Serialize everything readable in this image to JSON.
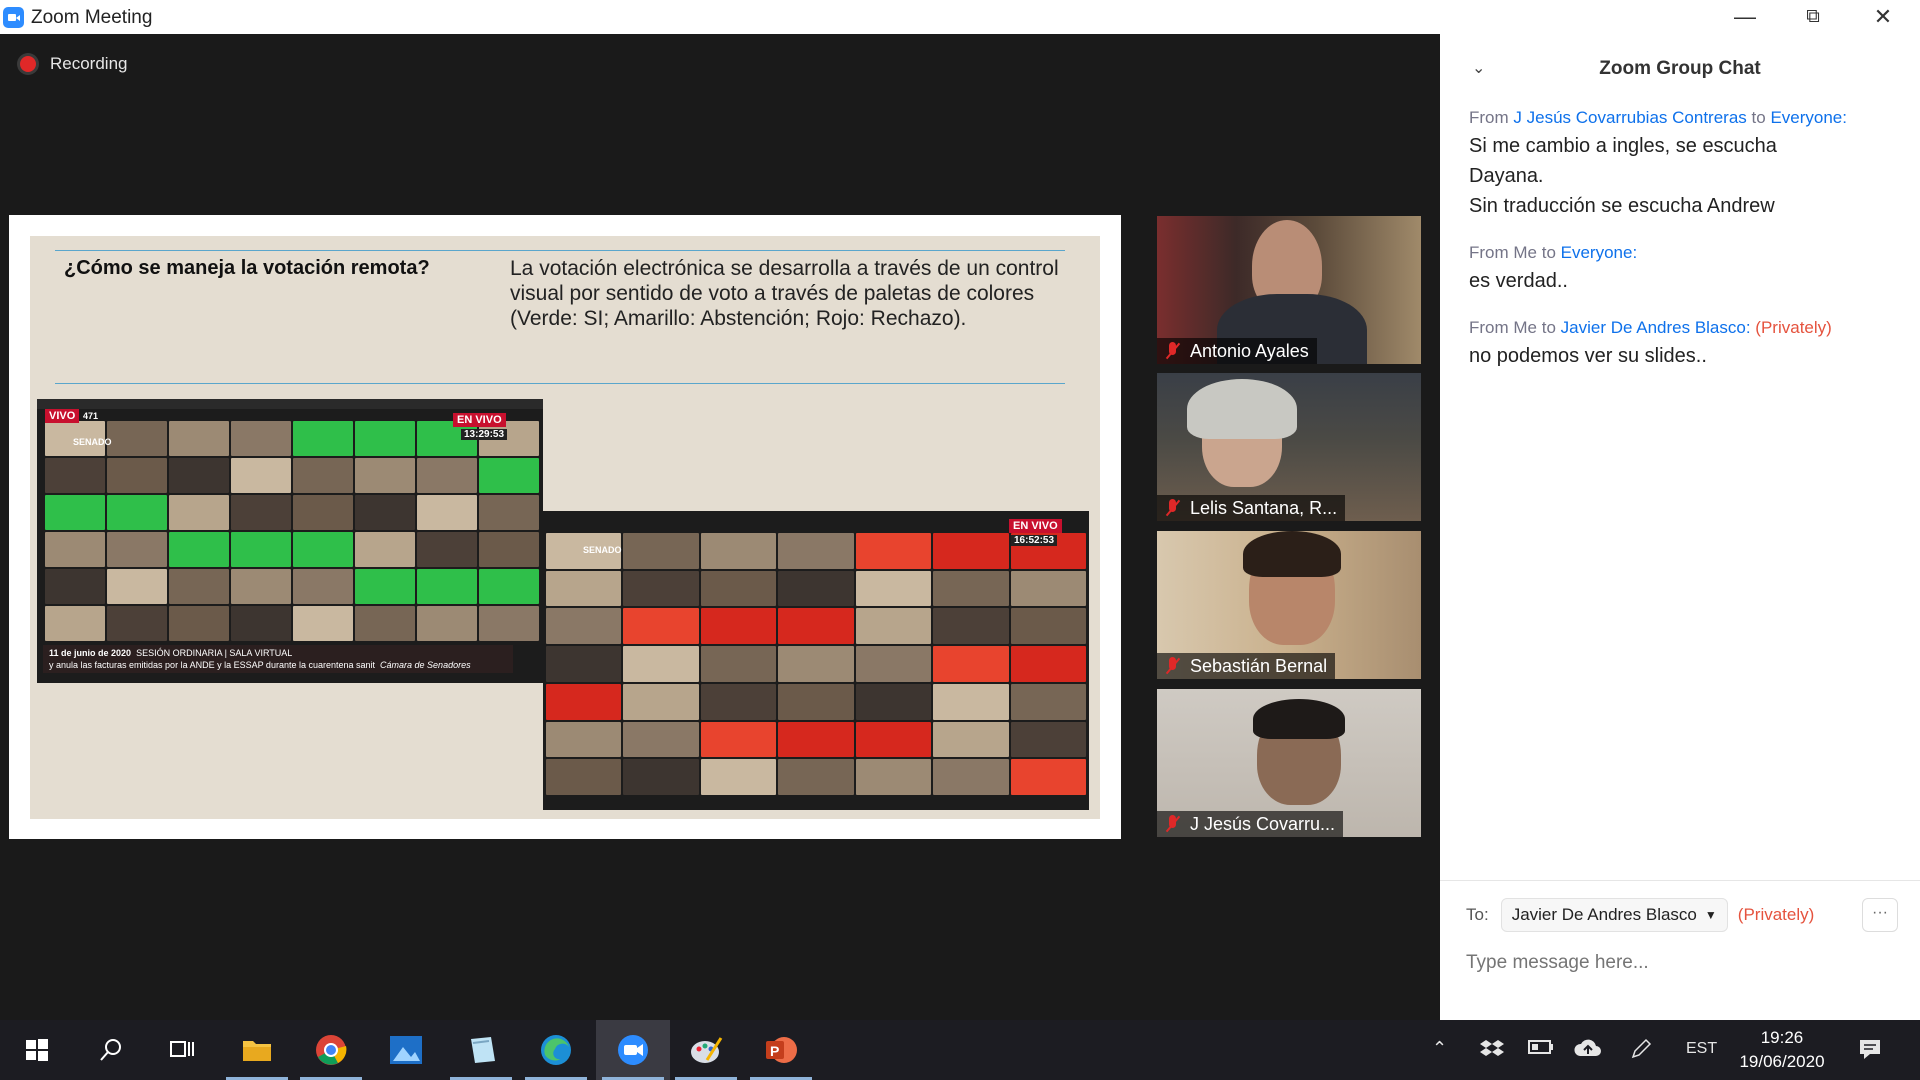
{
  "window": {
    "title": "Zoom Meeting",
    "minimize_glyph": "—",
    "restore_glyph": "⧉",
    "close_glyph": "✕"
  },
  "meeting": {
    "recording_label": "Recording"
  },
  "slide": {
    "question": "¿Cómo se maneja la votación remota?",
    "answer": "La votación electrónica se desarrolla a través de un control visual por sentido de voto a través de paletas de colores (Verde: SI; Amarillo: Abstención; Rojo: Rechazo).",
    "left_image": {
      "vivo_badge": "VIVO",
      "viewers": "471",
      "live_badge": "EN VIVO",
      "time": "13:29:53",
      "channel": "SENADO",
      "caption_date": "11 de junio de 2020",
      "caption_session": "SESIÓN ORDINARIA | SALA VIRTUAL",
      "caption_text": "y anula las facturas emitidas por la ANDE y la ESSAP durante la cuarentena sanit",
      "caption_chamber": "Cámara de Senadores"
    },
    "right_image": {
      "live_badge": "EN VIVO",
      "time": "16:52:53",
      "channel": "SENADO"
    }
  },
  "participants": [
    {
      "name": "Antonio Ayales",
      "muted": true
    },
    {
      "name": "Lelis Santana, R...",
      "muted": true
    },
    {
      "name": "Sebastián Bernal",
      "muted": true
    },
    {
      "name": "J Jesús Covarru...",
      "muted": true
    }
  ],
  "chat": {
    "title": "Zoom Group Chat",
    "messages": [
      {
        "from_prefix": "From",
        "sender": "J Jesús Covarrubias Contreras",
        "to_word": "to",
        "recipient": "Everyone:",
        "private_tag": "",
        "body_lines": [
          "Si me cambio a ingles, se escucha",
          "Dayana.",
          "Sin traducción se escucha Andrew"
        ]
      },
      {
        "from_prefix": "From Me to",
        "sender": "",
        "to_word": "",
        "recipient": "Everyone:",
        "private_tag": "",
        "body_lines": [
          "es verdad.."
        ]
      },
      {
        "from_prefix": "From Me to",
        "sender": "",
        "to_word": "",
        "recipient": "Javier De Andres Blasco:",
        "private_tag": "(Privately)",
        "body_lines": [
          "no podemos ver su slides.."
        ]
      }
    ],
    "to_label": "To:",
    "to_value": "Javier De Andres Blasco",
    "to_private": "(Privately)",
    "more_label": "···",
    "input_placeholder": "Type message here..."
  },
  "taskbar": {
    "apps": [
      {
        "name": "start-button",
        "icon": "windows-icon"
      },
      {
        "name": "search-button",
        "icon": "search-icon"
      },
      {
        "name": "task-view-button",
        "icon": "task-view-icon"
      },
      {
        "name": "file-explorer",
        "icon": "folder-icon"
      },
      {
        "name": "chrome",
        "icon": "chrome-icon"
      },
      {
        "name": "photos",
        "icon": "photos-icon"
      },
      {
        "name": "notes-app",
        "icon": "notes-icon"
      },
      {
        "name": "edge",
        "icon": "edge-icon"
      },
      {
        "name": "zoom",
        "icon": "zoom-icon",
        "active": true
      },
      {
        "name": "paint",
        "icon": "paint-icon"
      },
      {
        "name": "powerpoint",
        "icon": "powerpoint-icon"
      }
    ],
    "language": "EST",
    "time": "19:26",
    "date": "19/06/2020"
  },
  "colors": {
    "accent_blue": "#0e71eb",
    "private_red": "#e5533e",
    "mute_red": "#e02828",
    "zoom_blue": "#2d8cff"
  }
}
